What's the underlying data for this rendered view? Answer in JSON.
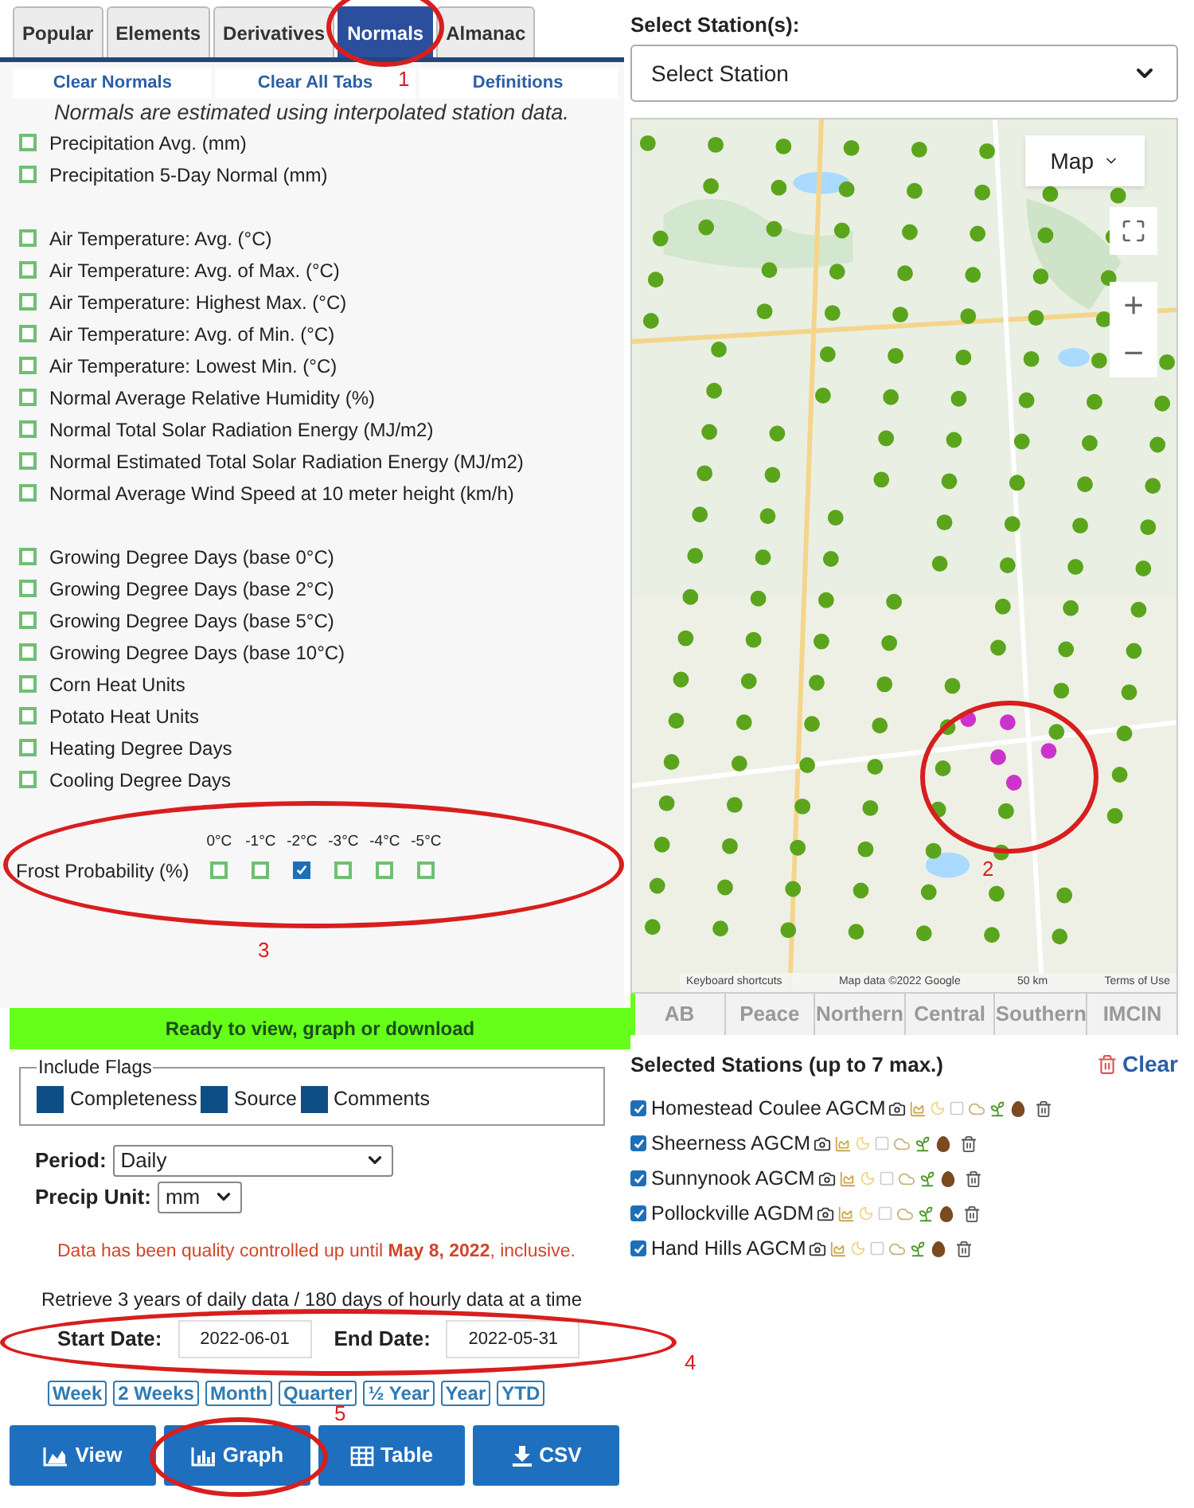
{
  "tabs": [
    {
      "label": "Popular",
      "selected": false
    },
    {
      "label": "Elements",
      "selected": false
    },
    {
      "label": "Derivatives",
      "selected": false
    },
    {
      "label": "Normals",
      "selected": true
    },
    {
      "label": "Almanac",
      "selected": false
    }
  ],
  "links": [
    "Clear Normals",
    "Clear All Tabs",
    "Definitions"
  ],
  "note": "Normals are estimated using interpolated station data.",
  "groups": [
    [
      {
        "label": "Precipitation Avg. (mm)",
        "checked": false
      },
      {
        "label": "Precipitation 5-Day Normal (mm)",
        "checked": false
      }
    ],
    [
      {
        "label": "Air Temperature: Avg. (°C)",
        "checked": false
      },
      {
        "label": "Air Temperature: Avg. of Max. (°C)",
        "checked": false
      },
      {
        "label": "Air Temperature: Highest Max. (°C)",
        "checked": false
      },
      {
        "label": "Air Temperature: Avg. of Min. (°C)",
        "checked": false
      },
      {
        "label": "Air Temperature: Lowest Min. (°C)",
        "checked": false
      },
      {
        "label": "Normal Average Relative Humidity (%)",
        "checked": false
      },
      {
        "label": "Normal Total Solar Radiation Energy (MJ/m2)",
        "checked": false
      },
      {
        "label": "Normal Estimated Total Solar Radiation Energy (MJ/m2)",
        "checked": false
      },
      {
        "label": "Normal Average Wind Speed at 10 meter height (km/h)",
        "checked": false
      }
    ],
    [
      {
        "label": "Growing Degree Days (base 0°C)",
        "checked": false
      },
      {
        "label": "Growing Degree Days (base 2°C)",
        "checked": false
      },
      {
        "label": "Growing Degree Days (base 5°C)",
        "checked": false
      },
      {
        "label": "Growing Degree Days (base 10°C)",
        "checked": false
      },
      {
        "label": "Corn Heat Units",
        "checked": false
      },
      {
        "label": "Potato Heat Units",
        "checked": false
      },
      {
        "label": "Heating Degree Days",
        "checked": false
      },
      {
        "label": "Cooling Degree Days",
        "checked": false
      }
    ]
  ],
  "frost": {
    "label": "Frost Probability (%)",
    "options": [
      {
        "label": "0°C",
        "checked": false
      },
      {
        "label": "-1°C",
        "checked": false
      },
      {
        "label": "-2°C",
        "checked": true
      },
      {
        "label": "-3°C",
        "checked": false
      },
      {
        "label": "-4°C",
        "checked": false
      },
      {
        "label": "-5°C",
        "checked": false
      }
    ]
  },
  "status": "Ready to view, graph or download",
  "station_select": {
    "label": "Select Station(s):",
    "value": "Select Station"
  },
  "map": {
    "type_button": "Map",
    "zoom_in": "+",
    "zoom_out": "−",
    "attribution": [
      "Keyboard shortcuts",
      "Map data ©2022 Google",
      "50 km",
      "Terms of Use"
    ]
  },
  "region_tabs": [
    "AB",
    "Peace",
    "Northern",
    "Central",
    "Southern",
    "IMCIN"
  ],
  "selected_stations": {
    "title": "Selected Stations (up to 7 max.)",
    "clear": "Clear",
    "items": [
      {
        "name": "Homestead Coulee AGCM",
        "checked": true
      },
      {
        "name": "Sheerness AGCM",
        "checked": true
      },
      {
        "name": "Sunnynook AGCM",
        "checked": true
      },
      {
        "name": "Pollockville AGDM",
        "checked": true
      },
      {
        "name": "Hand Hills AGCM",
        "checked": true
      }
    ]
  },
  "flags": {
    "legend": "Include Flags",
    "items": [
      {
        "label": "Completeness",
        "checked": true
      },
      {
        "label": "Source",
        "checked": true
      },
      {
        "label": "Comments",
        "checked": true
      }
    ]
  },
  "period": {
    "label": "Period:",
    "value": "Daily"
  },
  "precip_unit": {
    "label": "Precip Unit:",
    "value": "mm"
  },
  "qc_note": "Data has been quality controlled up until **May 8, 2022**, inclusive.",
  "retrieve_note": "Retrieve 3 years of daily data / 180 days of hourly data at a time",
  "start_date": {
    "label": "Start Date:",
    "value": "2022-06-01"
  },
  "end_date": {
    "label": "End Date:",
    "value": "2022-05-31"
  },
  "presets": [
    "Week",
    "2 Weeks",
    "Month",
    "Quarter",
    "½ Year",
    "Year",
    "YTD"
  ],
  "actions": [
    {
      "label": "View",
      "kind": "view"
    },
    {
      "label": "Graph",
      "kind": "graph"
    },
    {
      "label": "Table",
      "kind": "table"
    },
    {
      "label": "CSV",
      "kind": "csv"
    }
  ],
  "annotations": [
    "1",
    "2",
    "3",
    "4",
    "5"
  ]
}
